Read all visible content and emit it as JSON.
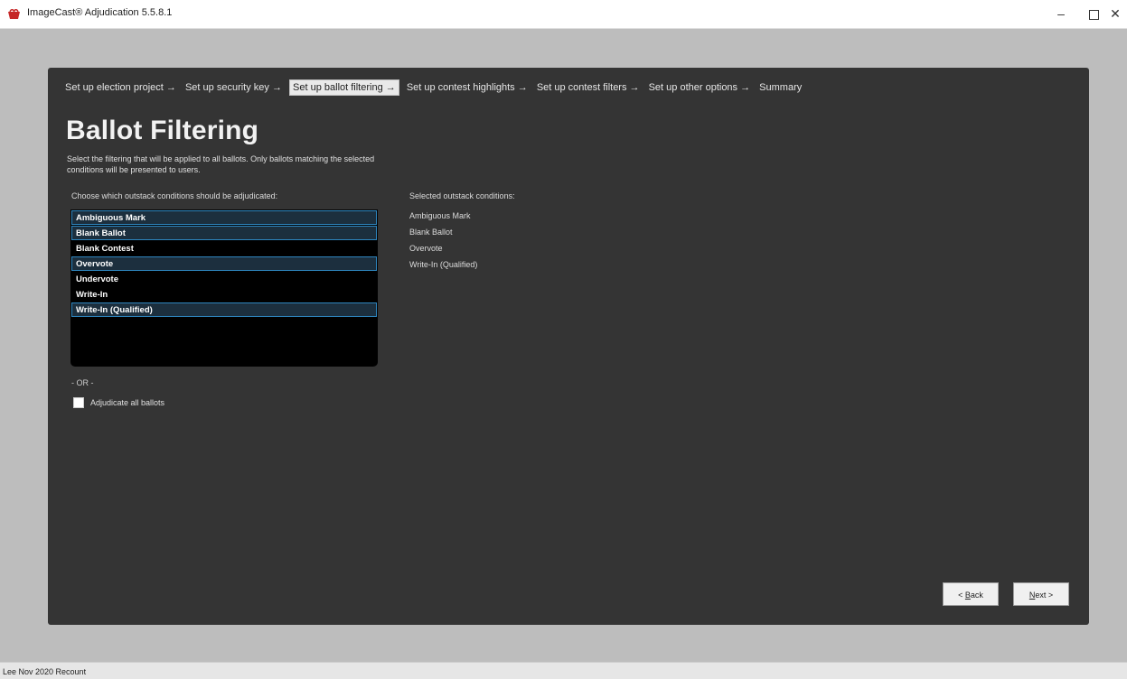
{
  "window": {
    "title": "ImageCast® Adjudication 5.5.8.1",
    "min_glyph": "–",
    "close_glyph": "✕"
  },
  "wizard": {
    "steps": [
      {
        "label": "Set up election project →",
        "active": false
      },
      {
        "label": "Set up security key →",
        "active": false
      },
      {
        "label": "Set up ballot filtering →",
        "active": true
      },
      {
        "label": "Set up contest highlights →",
        "active": false
      },
      {
        "label": "Set up contest filters →",
        "active": false
      },
      {
        "label": "Set up other options →",
        "active": false
      },
      {
        "label": "Summary",
        "active": false
      }
    ]
  },
  "page": {
    "title": "Ballot Filtering",
    "description": "Select the filtering that will be applied to all ballots. Only ballots matching the selected conditions will be presented to users."
  },
  "conditions": {
    "label": "Choose which outstack conditions should be adjudicated:",
    "items": [
      {
        "label": "Ambiguous Mark",
        "selected": true
      },
      {
        "label": "Blank Ballot",
        "selected": true
      },
      {
        "label": "Blank Contest",
        "selected": false
      },
      {
        "label": "Overvote",
        "selected": true
      },
      {
        "label": "Undervote",
        "selected": false
      },
      {
        "label": "Write-In",
        "selected": false
      },
      {
        "label": "Write-In (Qualified)",
        "selected": true
      }
    ]
  },
  "selected_conditions": {
    "label": "Selected outstack conditions:",
    "items": [
      "Ambiguous Mark",
      "Blank Ballot",
      "Overvote",
      "Write-In (Qualified)"
    ]
  },
  "or_text": "- OR -",
  "adjudicate_all": {
    "label": "Adjudicate all ballots",
    "checked": false
  },
  "buttons": {
    "back_mnemonic": "B",
    "back_rest": "ack",
    "back_prefix": "< ",
    "next_mnemonic": "N",
    "next_rest": "ext",
    "next_suffix": " >"
  },
  "status": {
    "text": "Lee Nov 2020 Recount"
  },
  "colors": {
    "panel_bg": "#343434",
    "selection_border": "#2e86bf",
    "app_icon": "#c62828"
  }
}
